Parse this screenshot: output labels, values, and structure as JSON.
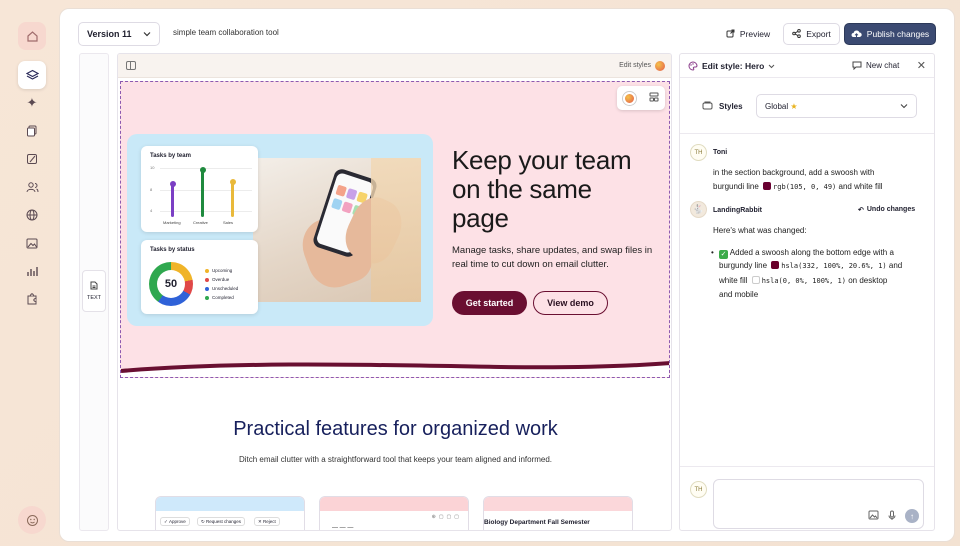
{
  "rail": {
    "items": [
      "home-icon",
      "layers-icon",
      "sparkles-icon",
      "pages-icon",
      "brush-icon",
      "users-icon",
      "globe-icon",
      "image-icon",
      "chart-icon",
      "puzzle-icon"
    ],
    "profile": "face-icon"
  },
  "topbar": {
    "version_label": "Version 11",
    "project_title": "simple team collaboration tool",
    "preview_label": "Preview",
    "export_label": "Export",
    "publish_label": "Publish changes",
    "accent": "#3b4a72"
  },
  "canvas": {
    "edit_styles_label": "Edit styles",
    "text_tool_label": "TEXT",
    "hero": {
      "title": "Keep your team on the same page",
      "subtitle": "Manage tasks, share updates, and swap files in real time to cut down on email clutter.",
      "primary_cta": "Get started",
      "secondary_cta": "View demo",
      "background": "#fde1e6",
      "swoosh_color": "#690f31",
      "card_team": {
        "title": "Tasks by team",
        "ticks": [
          "10",
          "8",
          "4"
        ],
        "bars": [
          {
            "label": "Marketing",
            "value": 0.68,
            "color": "#7b3fc4"
          },
          {
            "label": "Creative",
            "value": 0.95,
            "color": "#1f8a3e"
          },
          {
            "label": "Sales",
            "value": 0.72,
            "color": "#e9b93a"
          }
        ]
      },
      "card_status": {
        "title": "Tasks by status",
        "center_value": "50",
        "legend": [
          {
            "label": "Upcoming",
            "color": "#f0b429"
          },
          {
            "label": "Overdue",
            "color": "#e04848"
          },
          {
            "label": "Unscheduled",
            "color": "#2f62d8"
          },
          {
            "label": "Completed",
            "color": "#2fa84f"
          }
        ]
      }
    },
    "features": {
      "title": "Practical features for organized work",
      "subtitle": "Ditch email clutter with a straightforward tool that keeps your team aligned and informed.",
      "card1_pills": [
        "Approve",
        "Request changes",
        "Reject"
      ],
      "card3_title": "Biology Department Fall Semester"
    }
  },
  "panel": {
    "title": "Edit style: Hero",
    "new_chat_label": "New chat",
    "styles_label": "Styles",
    "styles_value": "Global",
    "messages": {
      "user_initials": "TH",
      "user_name": "Toni",
      "user_text_1": "in the section background, add a swoosh with",
      "user_text_2_prefix": "burgundi line",
      "user_text_2_code": "rgb(105, 0, 49)",
      "user_text_2_suffix": "and white fill",
      "bot_name": "LandingRabbit",
      "undo_label": "Undo changes",
      "bot_heading": "Here's what was changed:",
      "bullet_line1": "Added a swoosh along the bottom edge with a",
      "bullet_line2_prefix": "burgundy line",
      "bullet_line2_code": "hsla(332, 100%, 20.6%, 1)",
      "bullet_line2_suffix": "and",
      "bullet_line3_prefix": "white fill",
      "bullet_line3_code": "hsla(0, 0%, 100%, 1)",
      "bullet_line3_suffix": "on desktop",
      "bullet_line4": "and mobile"
    },
    "composer_initials": "TH"
  }
}
